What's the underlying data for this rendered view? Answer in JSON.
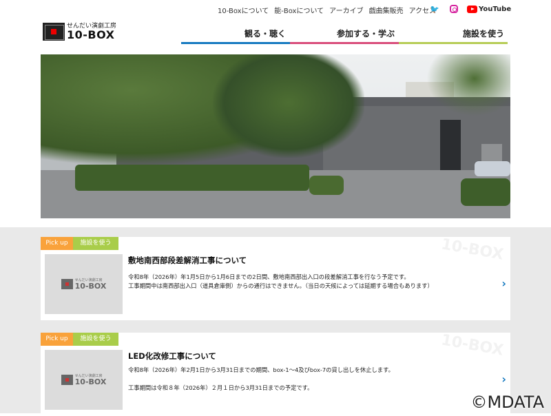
{
  "topnav": {
    "items": [
      "10-Boxについて",
      "能-Boxについて",
      "アーカイブ",
      "戯曲集販売",
      "アクセス"
    ],
    "youtube_label": "YouTube"
  },
  "icons": {
    "twitter": "twitter-icon",
    "instagram": "instagram-icon",
    "youtube": "youtube-icon"
  },
  "logo": {
    "subtitle": "せんだい演劇工房",
    "name": "10-BOX"
  },
  "mainnav": {
    "items": [
      "観る・聴く",
      "参加する・学ぶ",
      "施設を使う"
    ]
  },
  "colors": {
    "nav1": "#1479c0",
    "nav2": "#d94b7a",
    "nav3": "#b6cc55",
    "pickup": "#f9a23b",
    "category": "#a9cd4a"
  },
  "cards": [
    {
      "pickup": "Pick up",
      "category": "施設を使う",
      "title": "敷地南西部段差解消工事について",
      "lines": [
        "令和8年（2026年）年1月5日から1月6日までの2日間、敷地南西部出入口の段差解消工事を行なう予定です。",
        "工事期間中は南西部出入口（道具倉庫側）からの通行はできません。（当日の天候によっては延期する場合もあります）"
      ]
    },
    {
      "pickup": "Pick up",
      "category": "施設を使う",
      "title": "LED化改修工事について",
      "lines": [
        "令和8年（2026年）年2月1日から3月31日までの期間、box-1～4及びbox-7の貸し出しを休止します。",
        "",
        "工事期間は令和８年（2026年）２月１日から3月31日までの予定です。"
      ]
    }
  ],
  "watermark": "©MDATA"
}
